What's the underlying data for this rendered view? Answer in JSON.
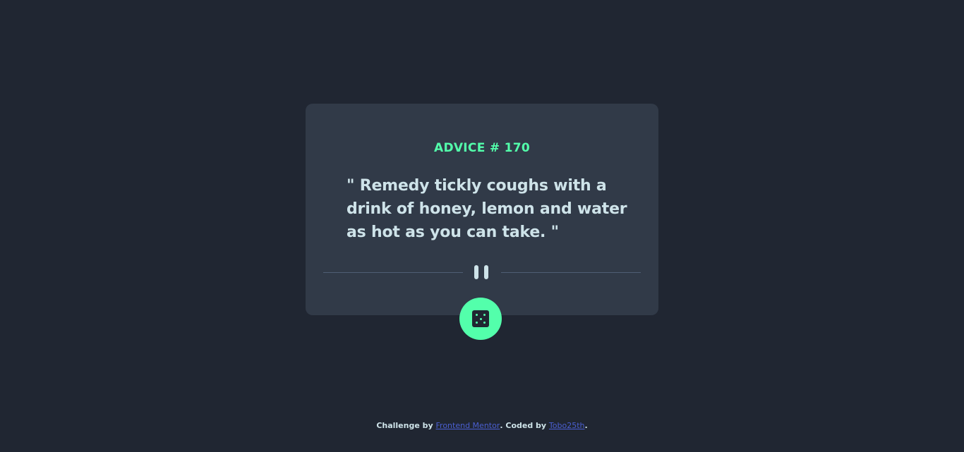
{
  "advice": {
    "label": "ADVICE # 170",
    "quote": "\" Remedy tickly coughs with a drink of honey, lemon and water as hot as you can take. \""
  },
  "divider": {
    "icon": "pause-icon"
  },
  "dice_button": {
    "icon": "dice-icon"
  },
  "footer": {
    "prefix": "Challenge by ",
    "link1": "Frontend Mentor",
    "middle": ". Coded by ",
    "link2": "Tobo25th",
    "suffix": "."
  },
  "colors": {
    "background": "#202632",
    "card": "#313a48",
    "accent": "#53ffab",
    "text": "#cee3e9",
    "link": "#4a5fd1",
    "divider": "#4f5d74"
  }
}
